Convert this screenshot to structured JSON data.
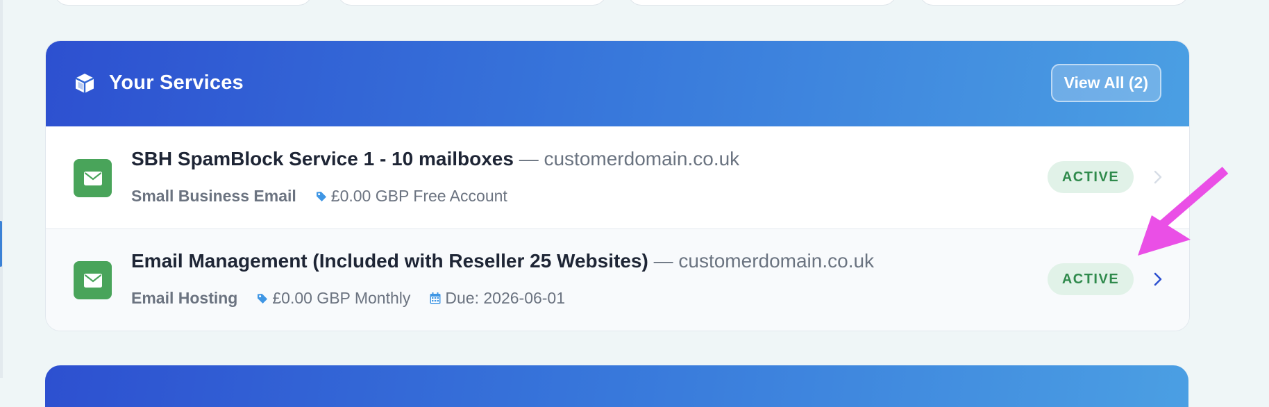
{
  "services": {
    "title": "Your Services",
    "title_icon": "cube-icon",
    "view_all_label": "View All (2)",
    "items": [
      {
        "name": "SBH SpamBlock Service 1 - 10 mailboxes",
        "separator": " — ",
        "domain": "customerdomain.co.uk",
        "group": "Small Business Email",
        "price": "£0.00 GBP Free Account",
        "due": "",
        "status": "ACTIVE",
        "icon": "envelope-icon"
      },
      {
        "name": "Email Management (Included with Reseller 25 Websites)",
        "separator": " — ",
        "domain": "customerdomain.co.uk",
        "group": "Email Hosting",
        "price": "£0.00 GBP Monthly",
        "due": "Due: 2026-06-01",
        "status": "ACTIVE",
        "icon": "envelope-icon"
      }
    ]
  },
  "colors": {
    "header_gradient_start": "#2d50d0",
    "header_gradient_end": "#4b9fe3",
    "service_icon_bg": "#49a45a",
    "status_badge_bg": "#e1f2e8",
    "status_badge_text": "#2f8a4c",
    "annotation_arrow": "#ea4fe6"
  }
}
